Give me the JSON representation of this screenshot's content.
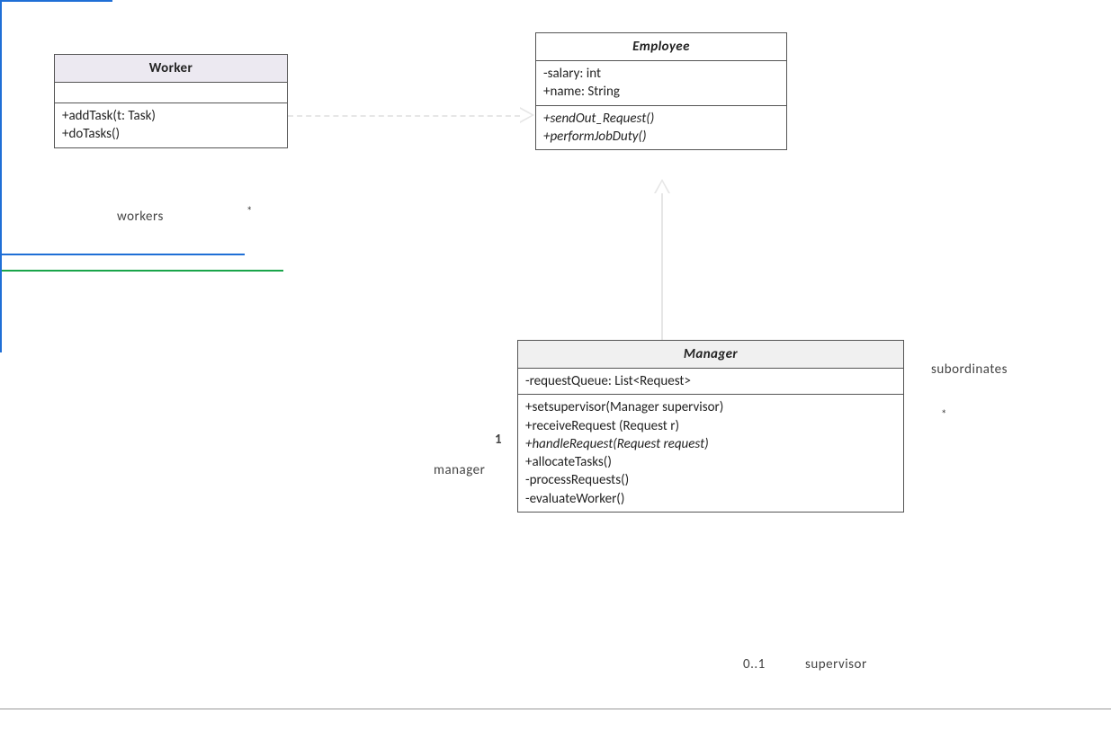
{
  "classes": {
    "worker": {
      "name": "Worker",
      "methods": [
        "+addTask(t: Task)",
        "+doTasks()"
      ]
    },
    "employee": {
      "name": "Employee",
      "attrs": [
        "-salary: int",
        "+name: String"
      ],
      "methods_italic": [
        "+sendOut_Request()",
        "+performJobDuty()"
      ]
    },
    "manager": {
      "name": "Manager",
      "attrs": [
        "-requestQueue: List<Request>"
      ],
      "methods": [
        "+setsupervisor(Manager supervisor)",
        "+receiveRequest (Request r)",
        "+handleRequest(Request request)",
        "+allocateTasks()",
        "-processRequests()",
        "-evaluateWorker()"
      ],
      "methods_italic_idx": [
        2
      ]
    }
  },
  "labels": {
    "workers": "workers",
    "workers_mult": "*",
    "manager": "manager",
    "manager_mult": "1",
    "subordinates": "subordinates",
    "subordinates_mult": "*",
    "supervisor": "supervisor",
    "supervisor_mult": "0..1"
  },
  "colors": {
    "green": "#1aa54a",
    "blue": "#1f6fd6",
    "faint": "#e3e3e3"
  }
}
